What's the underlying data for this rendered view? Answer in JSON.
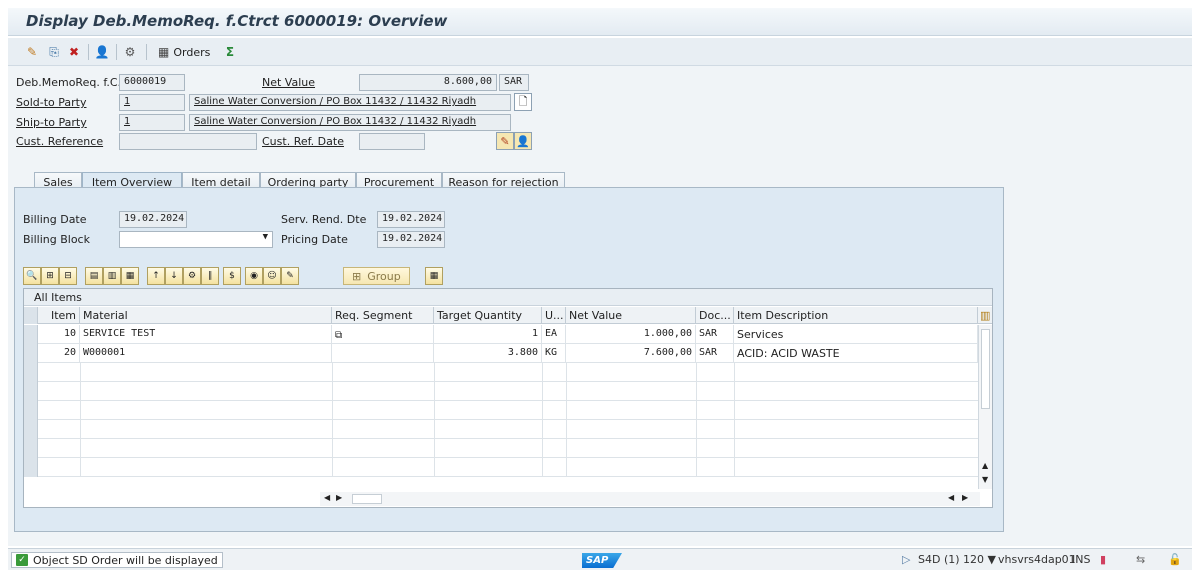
{
  "title": "Display Deb.MemoReq. f.Ctrct 6000019: Overview",
  "toolbar": {
    "orders_label": "Orders"
  },
  "header": {
    "doc_label": "Deb.MemoReq. f.C..",
    "doc_value": "6000019",
    "net_value_label": "Net Value",
    "net_value": "8.600,00",
    "currency": "SAR",
    "sold_to_label": "Sold-to Party",
    "sold_to_value": "1",
    "sold_to_desc": "Saline Water Conversion / PO Box 11432 / 11432 Riyadh",
    "ship_to_label": "Ship-to Party",
    "ship_to_value": "1",
    "ship_to_desc": "Saline Water Conversion / PO Box 11432 / 11432 Riyadh",
    "cust_ref_label": "Cust. Reference",
    "cust_ref_date_label": "Cust. Ref. Date"
  },
  "tabs": [
    {
      "label": "Sales"
    },
    {
      "label": "Item Overview"
    },
    {
      "label": "Item detail"
    },
    {
      "label": "Ordering party"
    },
    {
      "label": "Procurement"
    },
    {
      "label": "Reason for rejection"
    }
  ],
  "item_overview": {
    "billing_date_label": "Billing Date",
    "billing_date": "19.02.2024",
    "serv_rend_label": "Serv. Rend. Dte",
    "serv_rend_date": "19.02.2024",
    "billing_block_label": "Billing Block",
    "pricing_date_label": "Pricing Date",
    "pricing_date": "19.02.2024",
    "group_label": "Group"
  },
  "grid": {
    "title": "All Items",
    "columns": [
      "Item",
      "Material",
      "Req. Segment",
      "Target Quantity",
      "U...",
      "Net Value",
      "Doc...",
      "Item Description"
    ],
    "rows": [
      {
        "item": "10",
        "material": "SERVICE TEST",
        "qty": "1",
        "unit": "EA",
        "net": "1.000,00",
        "curr": "SAR",
        "desc": "Services"
      },
      {
        "item": "20",
        "material": "W000001",
        "qty": "3.800",
        "unit": "KG",
        "net": "7.600,00",
        "curr": "SAR",
        "desc": "ACID: ACID WASTE"
      }
    ]
  },
  "status": {
    "message": "Object SD Order will be displayed",
    "system": "S4D (1) 120",
    "host": "vhsvrs4dap01",
    "mode": "INS"
  }
}
